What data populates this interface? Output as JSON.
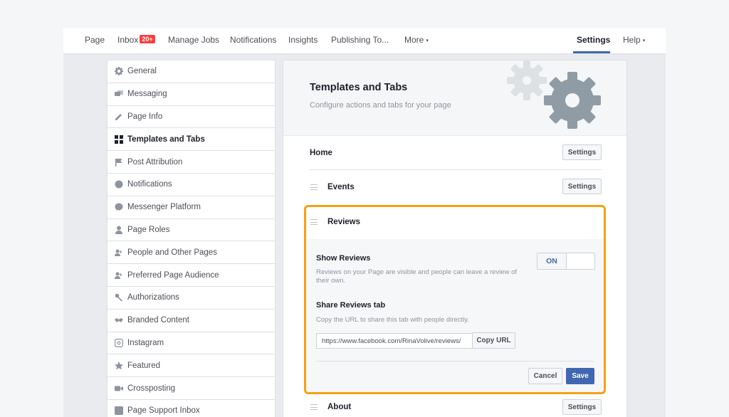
{
  "nav": {
    "items": [
      {
        "label": "Page"
      },
      {
        "label": "Inbox",
        "badge": "20+"
      },
      {
        "label": "Manage Jobs"
      },
      {
        "label": "Notifications"
      },
      {
        "label": "Insights"
      },
      {
        "label": "Publishing To..."
      },
      {
        "label": "More",
        "caret": "▾"
      }
    ],
    "settings": "Settings",
    "help": "Help",
    "help_caret": "▾"
  },
  "sidebar": {
    "items": [
      {
        "label": "General",
        "icon": "gear-icon"
      },
      {
        "label": "Messaging",
        "icon": "messages-icon"
      },
      {
        "label": "Page Info",
        "icon": "pencil-icon"
      },
      {
        "label": "Templates and Tabs",
        "icon": "grid-icon",
        "active": true
      },
      {
        "label": "Post Attribution",
        "icon": "flag-icon"
      },
      {
        "label": "Notifications",
        "icon": "globe-icon"
      },
      {
        "label": "Messenger Platform",
        "icon": "messenger-icon"
      },
      {
        "label": "Page Roles",
        "icon": "person-icon"
      },
      {
        "label": "People and Other Pages",
        "icon": "people-icon"
      },
      {
        "label": "Preferred Page Audience",
        "icon": "people-icon"
      },
      {
        "label": "Authorizations",
        "icon": "wrench-icon"
      },
      {
        "label": "Branded Content",
        "icon": "handshake-icon"
      },
      {
        "label": "Instagram",
        "icon": "instagram-icon"
      },
      {
        "label": "Featured",
        "icon": "star-icon"
      },
      {
        "label": "Crossposting",
        "icon": "video-icon"
      },
      {
        "label": "Page Support Inbox",
        "icon": "facebook-icon"
      }
    ]
  },
  "main": {
    "title": "Templates and Tabs",
    "subtitle": "Configure actions and tabs for your page",
    "home_label": "Home",
    "events_label": "Events",
    "reviews_label": "Reviews",
    "about_label": "About",
    "settings_btn": "Settings",
    "reviews": {
      "show_label": "Show Reviews",
      "show_help": "Reviews on your Page are visible and people can leave a review of their own.",
      "toggle_on": "ON",
      "share_label": "Share Reviews tab",
      "share_help": "Copy the URL to share this tab with people directly.",
      "url_value": "https://www.facebook.com/RinaVolive/reviews/",
      "copy_btn": "Copy URL",
      "cancel_btn": "Cancel",
      "save_btn": "Save"
    }
  },
  "colors": {
    "accent": "#4267b2",
    "highlight": "#f5a015",
    "badge": "#fa3e3e"
  }
}
